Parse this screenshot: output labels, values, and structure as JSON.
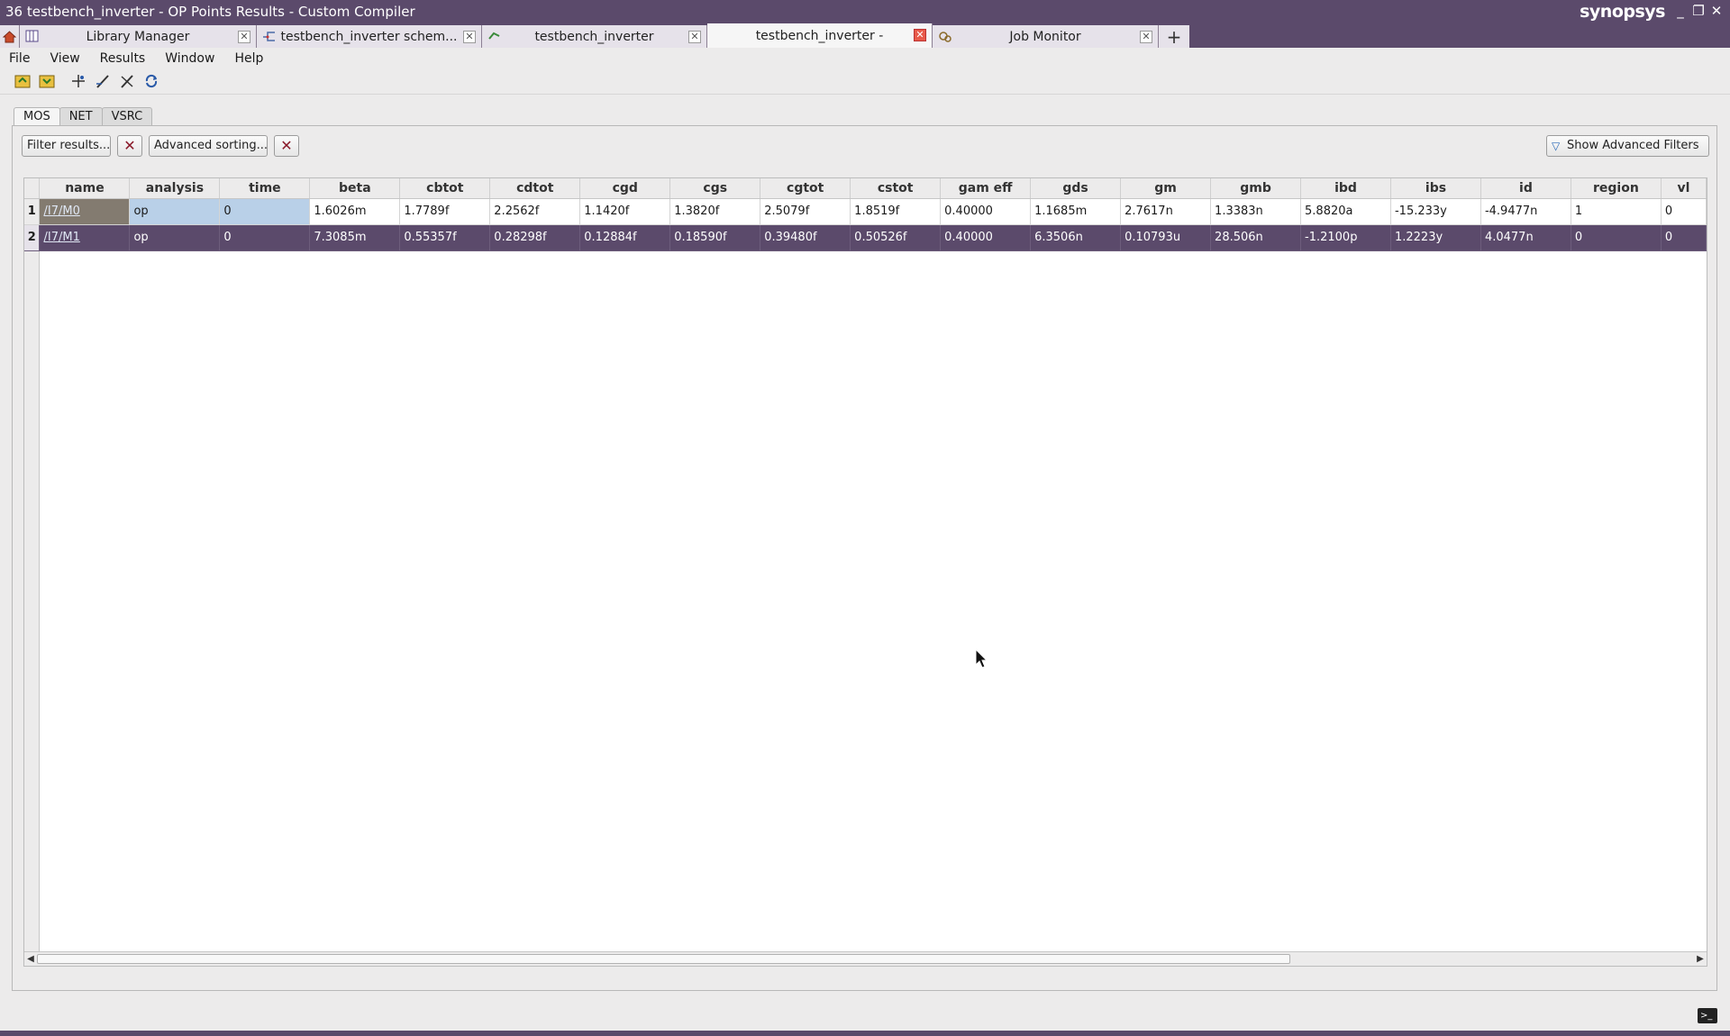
{
  "window": {
    "title": "36 testbench_inverter - OP Points Results - Custom Compiler",
    "brand": "synopsys"
  },
  "app_tabs": [
    {
      "label": "Library Manager",
      "icon": "library-icon",
      "active": false
    },
    {
      "label": "testbench_inverter schem...",
      "icon": "schematic-icon",
      "active": false
    },
    {
      "label": "testbench_inverter",
      "icon": "testbench-icon",
      "active": false
    },
    {
      "label": "testbench_inverter -",
      "icon": "",
      "active": true
    },
    {
      "label": "Job Monitor",
      "icon": "job-monitor-icon",
      "active": false
    }
  ],
  "menu": [
    "File",
    "View",
    "Results",
    "Window",
    "Help"
  ],
  "toolbar_icons": [
    "export-icon",
    "import-icon",
    "probe-icon",
    "annotate-icon",
    "clear-annotation-icon",
    "refresh-icon"
  ],
  "result_tabs": [
    "MOS",
    "NET",
    "VSRC"
  ],
  "filters": {
    "filter_label": "Filter results...",
    "sorting_label": "Advanced sorting...",
    "advanced_filters_label": "Show Advanced Filters"
  },
  "table": {
    "columns": [
      "name",
      "analysis",
      "time",
      "beta",
      "cbtot",
      "cdtot",
      "cgd",
      "cgs",
      "cgtot",
      "cstot",
      "gam eff",
      "gds",
      "gm",
      "gmb",
      "ibd",
      "ibs",
      "id",
      "region",
      "vl"
    ],
    "rows": [
      {
        "num": "1",
        "cells": [
          "/I7/M0",
          "op",
          "0",
          "1.6026m",
          "1.7789f",
          "2.2562f",
          "1.1420f",
          "1.3820f",
          "2.5079f",
          "1.8519f",
          "0.40000",
          "1.1685m",
          "2.7617n",
          "1.3383n",
          "5.8820a",
          "-15.233y",
          "-4.9477n",
          "1",
          "0"
        ]
      },
      {
        "num": "2",
        "cells": [
          "/I7/M1",
          "op",
          "0",
          "7.3085m",
          "0.55357f",
          "0.28298f",
          "0.12884f",
          "0.18590f",
          "0.39480f",
          "0.50526f",
          "0.40000",
          "6.3506n",
          "0.10793u",
          "28.506n",
          "-1.2100p",
          "1.2223y",
          "4.0477n",
          "0",
          "0"
        ]
      }
    ]
  },
  "colors": {
    "accent": "#5b4a6b",
    "selected_row": "#5b4a6b",
    "cell_highlight": "#b9d0e8",
    "close_active": "#e85a4a"
  }
}
